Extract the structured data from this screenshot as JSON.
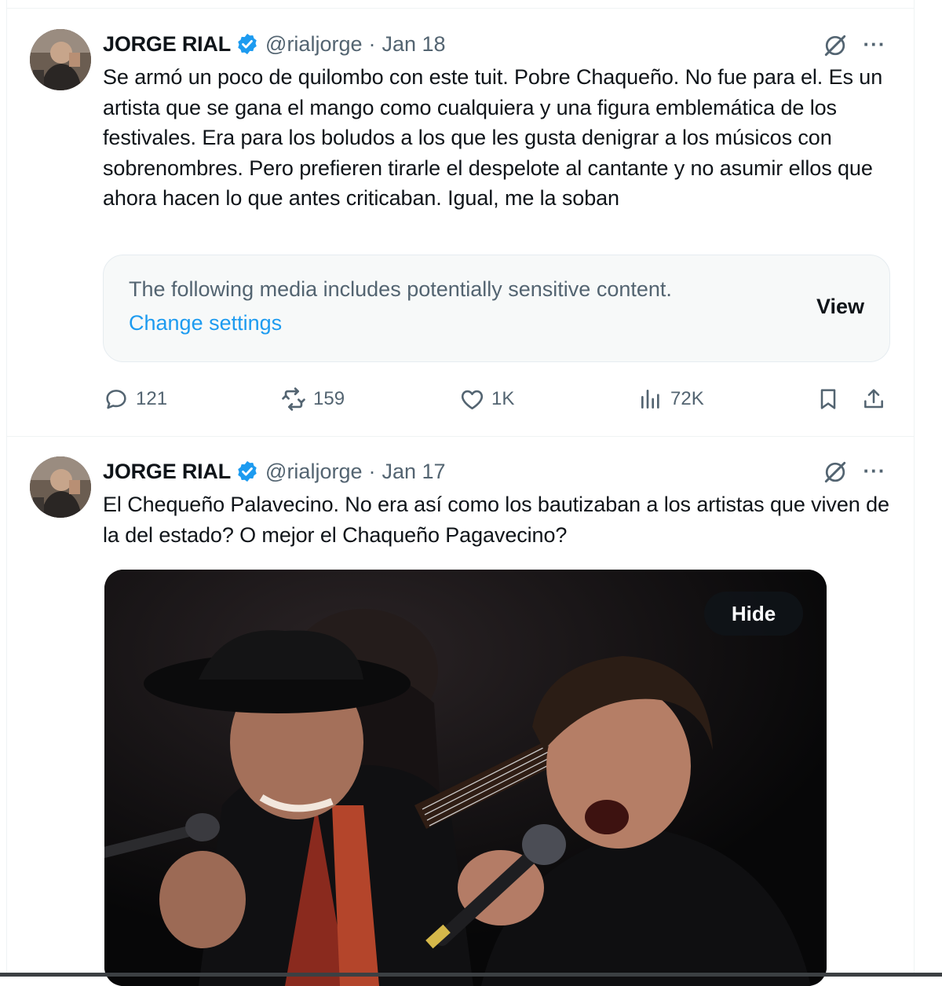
{
  "tweets": [
    {
      "author": {
        "name": "JORGE RIAL",
        "handle": "@rialjorge",
        "verified": true
      },
      "date": "Jan 18",
      "text": "Se armó un poco de quilombo con este tuit. Pobre Chaqueño. No fue para el. Es un artista que se gana el mango como cualquiera y una figura emblemática de los festivales. Era para los boludos a los que les gusta denigrar a los músicos con sobrenombres. Pero prefieren tirarle el despelote al cantante y no asumir ellos que ahora hacen lo que antes criticaban. Igual, me la soban",
      "sensitive_notice": {
        "message": "The following media includes potentially sensitive content.",
        "link": "Change settings",
        "action": "View"
      },
      "stats": {
        "replies": "121",
        "reposts": "159",
        "likes": "1K",
        "views": "72K"
      },
      "more_label": "···"
    },
    {
      "author": {
        "name": "JORGE RIAL",
        "handle": "@rialjorge",
        "verified": true
      },
      "date": "Jan 17",
      "text": "El Chequeño Palavecino. No era así como los bautizaban a los artistas que viven de la del estado? O mejor el Chaqueño Pagavecino?",
      "media": {
        "hide_label": "Hide"
      },
      "more_label": "···"
    }
  ],
  "separator": "·",
  "colors": {
    "accent": "#1d9bf0",
    "text": "#0f1419",
    "secondary": "#536471",
    "border": "#eff3f4"
  },
  "icons": [
    "grok-icon",
    "more-icon",
    "reply-icon",
    "repost-icon",
    "like-icon",
    "views-icon",
    "bookmark-icon",
    "share-icon",
    "verified-badge-icon"
  ]
}
